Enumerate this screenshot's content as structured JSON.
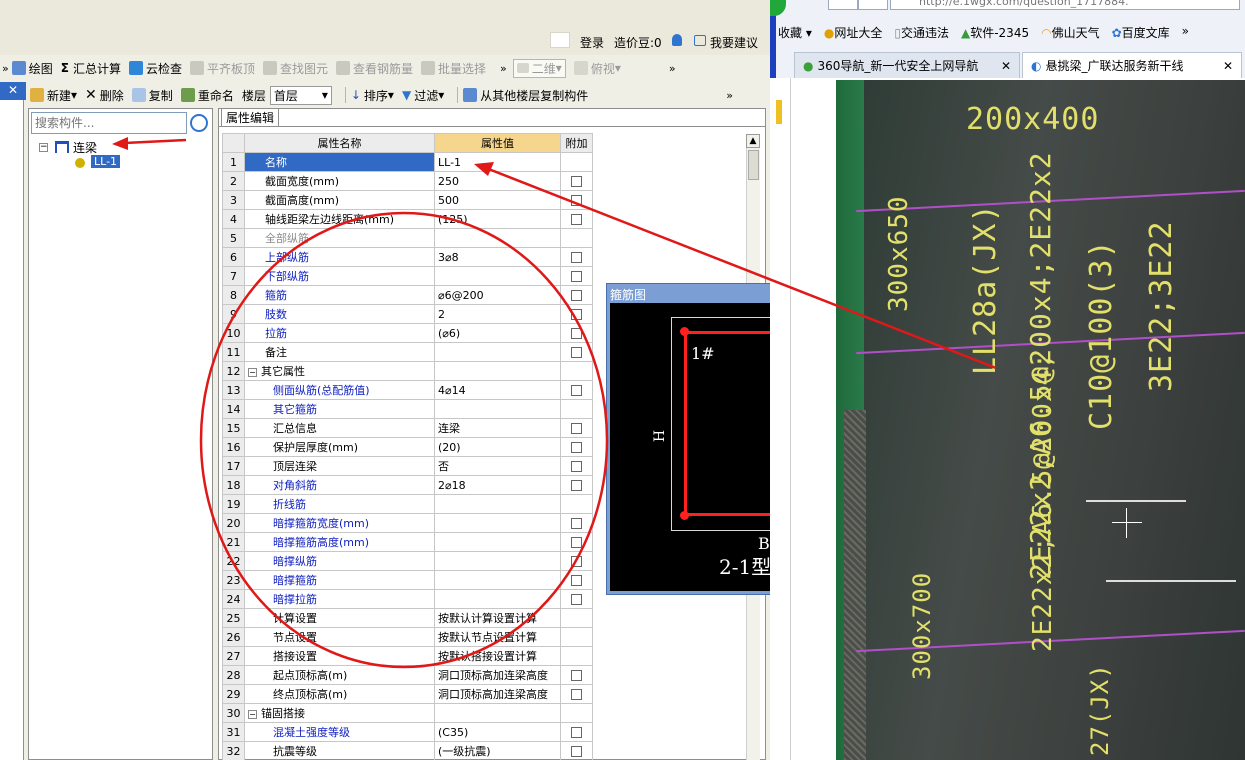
{
  "header": {
    "login": "登录",
    "coin": "造价豆:0",
    "suggest": "我要建议"
  },
  "toolbar1": {
    "draw": "绘图",
    "sum_calc": "汇总计算",
    "cloud_check": "云检查",
    "level_top": "平齐板顶",
    "find_elem": "查找图元",
    "view_rebar": "查看钢筋量",
    "batch_select": "批量选择",
    "view_2d": "二维",
    "view_persp": "俯视"
  },
  "toolbar2": {
    "new": "新建",
    "delete": "删除",
    "copy": "复制",
    "rename": "重命名",
    "floor_label": "楼层",
    "floor_value": "首层",
    "sort": "排序",
    "filter": "过滤",
    "copy_from": "从其他楼层复制构件"
  },
  "tree": {
    "search_placeholder": "搜索构件...",
    "root": "连梁",
    "child": "LL-1"
  },
  "props": {
    "tab": "属性编辑",
    "headers": [
      "属性名称",
      "属性值",
      "附加"
    ],
    "rows": [
      {
        "n": "1",
        "name": "名称",
        "value": "LL-1"
      },
      {
        "n": "2",
        "name": "截面宽度(mm)",
        "value": "250"
      },
      {
        "n": "3",
        "name": "截面高度(mm)",
        "value": "500"
      },
      {
        "n": "4",
        "name": "轴线距梁左边线距离(mm)",
        "value": "(125)"
      },
      {
        "n": "5",
        "name": "全部纵筋",
        "value": ""
      },
      {
        "n": "6",
        "name": "上部纵筋",
        "value": "3⌀8"
      },
      {
        "n": "7",
        "name": "下部纵筋",
        "value": ""
      },
      {
        "n": "8",
        "name": "箍筋",
        "value": "⌀6@200"
      },
      {
        "n": "9",
        "name": "肢数",
        "value": "2"
      },
      {
        "n": "10",
        "name": "拉筋",
        "value": "(⌀6)"
      },
      {
        "n": "11",
        "name": "备注",
        "value": ""
      },
      {
        "n": "12",
        "name": "其它属性",
        "value": ""
      },
      {
        "n": "13",
        "name": "侧面纵筋(总配筋值)",
        "value": "4⌀14"
      },
      {
        "n": "14",
        "name": "其它箍筋",
        "value": ""
      },
      {
        "n": "15",
        "name": "汇总信息",
        "value": "连梁"
      },
      {
        "n": "16",
        "name": "保护层厚度(mm)",
        "value": "(20)"
      },
      {
        "n": "17",
        "name": "顶层连梁",
        "value": "否"
      },
      {
        "n": "18",
        "name": "对角斜筋",
        "value": "2⌀18"
      },
      {
        "n": "19",
        "name": "折线筋",
        "value": ""
      },
      {
        "n": "20",
        "name": "暗撑箍筋宽度(mm)",
        "value": ""
      },
      {
        "n": "21",
        "name": "暗撑箍筋高度(mm)",
        "value": ""
      },
      {
        "n": "22",
        "name": "暗撑纵筋",
        "value": ""
      },
      {
        "n": "23",
        "name": "暗撑箍筋",
        "value": ""
      },
      {
        "n": "24",
        "name": "暗撑拉筋",
        "value": ""
      },
      {
        "n": "25",
        "name": "计算设置",
        "value": "按默认计算设置计算"
      },
      {
        "n": "26",
        "name": "节点设置",
        "value": "按默认节点设置计算"
      },
      {
        "n": "27",
        "name": "搭接设置",
        "value": "按默认搭接设置计算"
      },
      {
        "n": "28",
        "name": "起点顶标高(m)",
        "value": "洞口顶标高加连梁高度"
      },
      {
        "n": "29",
        "name": "终点顶标高(m)",
        "value": "洞口顶标高加连梁高度"
      },
      {
        "n": "30",
        "name": "锚固搭接",
        "value": ""
      },
      {
        "n": "31",
        "name": "混凝土强度等级",
        "value": "(C35)"
      },
      {
        "n": "32",
        "name": "抗震等级",
        "value": "(一级抗震)"
      }
    ]
  },
  "stirrup": {
    "title": "箍筋图",
    "label_1": "1#",
    "label_h": "H",
    "label_b": "B",
    "label_type": "2-1型"
  },
  "browser": {
    "url": "http://e.1wgx.com/question_1717884.",
    "favorites": "收藏",
    "bm1": "网址大全",
    "bm2": "交通违法",
    "bm3": "软件-2345",
    "bm4": "佛山天气",
    "bm5": "百度文库",
    "tab1": "360导航_新一代安全上网导航",
    "tab2": "悬挑梁_广联达服务新干线"
  },
  "photo": {
    "t1": "200x400",
    "t2": "300x650",
    "t3": "LL28a(JX)",
    "t4": "2E22x2;A6.5@200x4;2E22x2",
    "t5": "C10@100(3)",
    "t6": "3E22;3E22",
    "t7": "300x700",
    "t8": "2E22x2;A6.5@200x4;",
    "t9": "27(JX)"
  }
}
